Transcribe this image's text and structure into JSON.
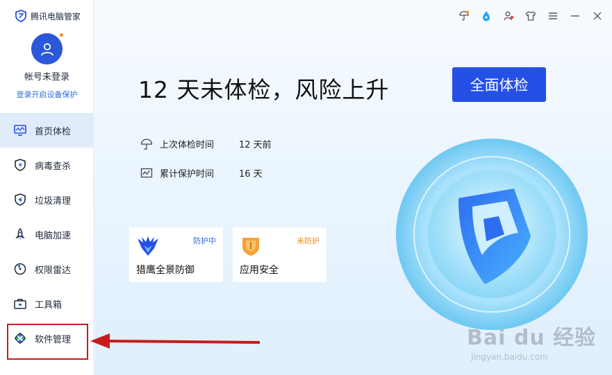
{
  "app": {
    "name": "腾讯电脑管家",
    "brand_color": "#2450e6"
  },
  "account": {
    "name": "帐号未登录",
    "login_prompt": "登录开启设备保护"
  },
  "sidebar": {
    "items": [
      {
        "label": "首页体检",
        "icon": "monitor-icon",
        "active": true
      },
      {
        "label": "病毒查杀",
        "icon": "lightning-shield-icon",
        "active": false
      },
      {
        "label": "垃圾清理",
        "icon": "broom-icon",
        "active": false
      },
      {
        "label": "电脑加速",
        "icon": "rocket-icon",
        "active": false
      },
      {
        "label": "权限雷达",
        "icon": "radar-icon",
        "active": false
      },
      {
        "label": "工具箱",
        "icon": "toolbox-icon",
        "active": false
      },
      {
        "label": "软件管理",
        "icon": "software-grid-icon",
        "active": false
      }
    ]
  },
  "main": {
    "headline": "12 天未体检，风险上升",
    "scan_button": "全面体检",
    "info": [
      {
        "label": "上次体检时间",
        "value": "12 天前",
        "icon": "umbrella-icon"
      },
      {
        "label": "累计保护时间",
        "value": "16 天",
        "icon": "chart-icon"
      }
    ],
    "cards": [
      {
        "title": "猎鹰全景防御",
        "status": "防护中",
        "status_color": "#2a6de0",
        "icon": "falcon-icon"
      },
      {
        "title": "应用安全",
        "status": "未防护",
        "status_color": "#f08a1c",
        "icon": "app-shield-icon"
      }
    ]
  },
  "watermark": {
    "text": "Bai du 经验",
    "url": "jingyan.baidu.com"
  }
}
